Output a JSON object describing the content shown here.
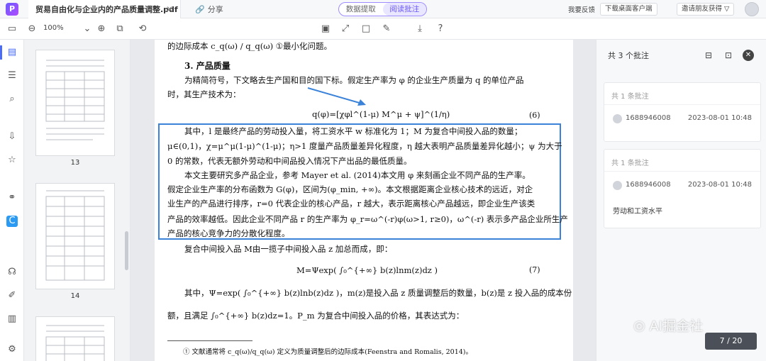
{
  "titlebar": {
    "doc_tab": "贸易自由化与企业内的产品质量调整.pdf",
    "share": "分享",
    "mode_tabs": [
      "数据提取",
      "阅读批注"
    ],
    "feedback": "我要反馈",
    "download_client": "下载桌面客户端",
    "invite": "邀请朋友获得"
  },
  "toolbar": {
    "zoom": "100%"
  },
  "thumbnails": [
    {
      "label": "13"
    },
    {
      "label": "14"
    },
    {
      "label": ""
    }
  ],
  "document": {
    "line0": "的边际成本 c_q(ω) / q_q(ω) ①最小化问题。",
    "section": "3. 产品质量",
    "p1a": "为精简符号，下文略去生产国和目的国下标。假定生产率为 φ 的企业生产质量为 q 的单位产品",
    "p1b": "时，其生产技术为：",
    "eq6": "q(φ)=[χφl^(1-μ) M^μ + ψ]^(1/η)",
    "eq6_num": "(6)",
    "h1": "其中，l 是最终产品的劳动投入量，将工资水平 w 标准化为 1；M 为复合中间投入品的数量；",
    "h2": "μ∈(0,1)，χ=μ^μ(1-μ)^(1-μ)；η>1 度量产品质量差异化程度，η 越大表明产品质量差异化越小；ψ 为大于",
    "h3": "0 的常数，代表无额外劳动和中间品投入情况下产出品的最低质量。",
    "h4": "本文主要研究多产品企业，参考 Mayer et al. (2014)本文用 φ 来刻画企业不同产品的生产率。",
    "h5": "假定企业生产率的分布函数为 G(φ)，区间为(φ_min, +∞)。本文根据距离企业核心技术的远近，对企",
    "h6": "业生产的产品进行排序，r=0 代表企业的核心产品，r 越大，表示距离核心产品越远，即企业生产该类",
    "h7": "产品的效率越低。因此企业不同产品 r 的生产率为 φ_r=ω^(-r)φ(ω>1, r≥0)，ω^(-r) 表示多产品企业所生产",
    "h8": "产品的核心竞争力的分散化程度。",
    "p3": "复合中间投入品 M由一揽子中间投入品 z 加总而成，即：",
    "eq7": "M=Ψexp( ∫₀^{+∞} b(z)lnm(z)dz )",
    "eq7_num": "(7)",
    "p4": "其中，Ψ=exp( ∫₀^{+∞} b(z)lnb(z)dz )，m(z)是投入品 z 质量调整后的数量，b(z)是 z 投入品的成本份",
    "p5": "额，且满足 ∫₀^{+∞} b(z)dz=1。P_m 为复合中间投入品的价格，其表达式为：",
    "footnote": "① 文献通常将 c_q(ω)/q_q(ω) 定义为质量调整后的边际成本(Feenstra and Romalis, 2014)。"
  },
  "annotations_panel": {
    "header": "共 3 个批注",
    "cards": [
      {
        "count": "共 1 条批注",
        "user": "1688946008",
        "time": "2023-08-01 10:48",
        "text": ""
      },
      {
        "count": "共 1 条批注",
        "user": "1688946008",
        "time": "2023-08-01 10:48",
        "text": "劳动和工资水平"
      }
    ]
  },
  "watermark": "AI掘金社",
  "page_indicator": {
    "current": "7",
    "total": "20",
    "text": "7  /  20"
  },
  "colors": {
    "accent": "#6b58ff",
    "highlight_box": "#3b82d9",
    "arrow": "#3b82d9"
  },
  "icons": [
    "app-logo-icon",
    "close-icon",
    "share-icon",
    "shield-icon",
    "folder-icon",
    "zoom-out-icon",
    "zoom-in-icon",
    "comment-icon",
    "arrow-icon",
    "rectangle-icon",
    "pen-icon",
    "export-icon",
    "help-icon"
  ]
}
